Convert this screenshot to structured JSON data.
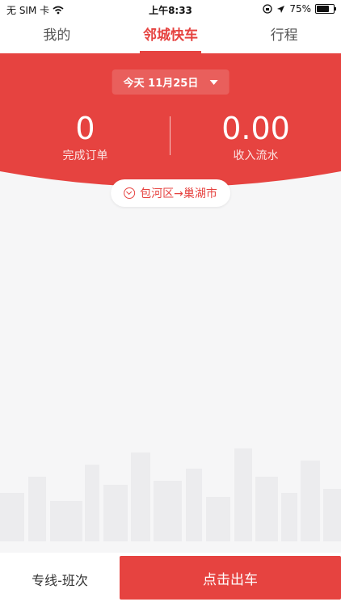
{
  "status_bar": {
    "carrier": "无 SIM 卡",
    "time": "上午8:33",
    "battery": "75%",
    "battery_fraction": 0.75
  },
  "tabs": [
    {
      "label": "我的",
      "active": false
    },
    {
      "label": "邻城快车",
      "active": true
    },
    {
      "label": "行程",
      "active": false
    }
  ],
  "header": {
    "date": "今天 11月25日",
    "stats": [
      {
        "value": "0",
        "label": "完成订单"
      },
      {
        "value": "0.00",
        "label": "收入流水"
      }
    ],
    "route": "包河区→巢湖市"
  },
  "bottom": {
    "line_label": "专线-班次",
    "go_label": "点击出车"
  },
  "colors": {
    "accent": "#e64340",
    "background": "#f6f6f7"
  }
}
